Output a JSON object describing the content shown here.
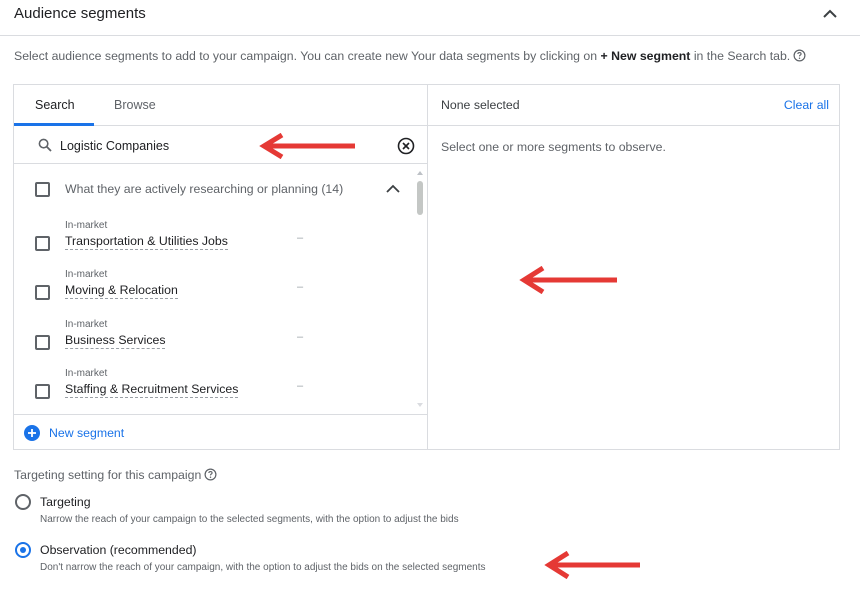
{
  "header": {
    "title": "Audience segments"
  },
  "intro": {
    "text_before": "Select audience segments to add to your campaign. You can create new Your data segments by clicking on ",
    "bold": "+ New segment",
    "text_after": " in the Search tab."
  },
  "tabs": {
    "search": "Search",
    "browse": "Browse",
    "active": "Search"
  },
  "search": {
    "value": "Logistic Companies"
  },
  "group": {
    "label": "What they are actively researching or planning (14)"
  },
  "items": [
    {
      "type": "In-market",
      "name": "Transportation & Utilities Jobs",
      "dash": "–"
    },
    {
      "type": "In-market",
      "name": "Moving & Relocation",
      "dash": "–"
    },
    {
      "type": "In-market",
      "name": "Business Services",
      "dash": "–"
    },
    {
      "type": "In-market",
      "name": "Staffing & Recruitment Services",
      "dash": "–"
    }
  ],
  "new_segment": {
    "label": "New segment"
  },
  "selected_panel": {
    "status": "None selected",
    "clear_all": "Clear all",
    "empty_message": "Select one or more segments to observe."
  },
  "targeting": {
    "title": "Targeting setting for this campaign",
    "options": [
      {
        "label": "Targeting",
        "description": "Narrow the reach of your campaign to the selected segments, with the option to adjust the bids",
        "selected": false
      },
      {
        "label": "Observation (recommended)",
        "description": "Don't narrow the reach of your campaign, with the option to adjust the bids on the selected segments",
        "selected": true
      }
    ]
  },
  "colors": {
    "accent": "#1a73e8",
    "arrow": "#e53935",
    "border": "#dadce0"
  }
}
